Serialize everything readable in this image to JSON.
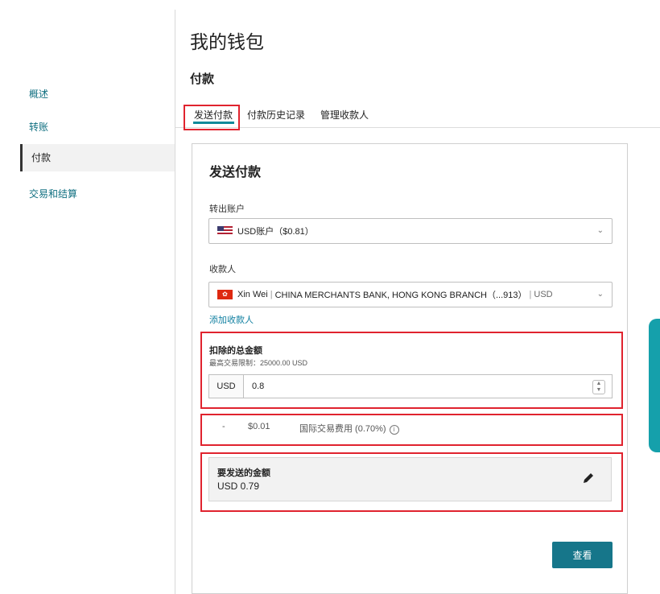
{
  "sidebar": {
    "items": [
      {
        "label": "概述"
      },
      {
        "label": "转账"
      },
      {
        "label": "付款"
      },
      {
        "label": "交易和结算"
      }
    ]
  },
  "header": {
    "title": "我的钱包",
    "section": "付款"
  },
  "tabs": [
    {
      "label": "发送付款"
    },
    {
      "label": "付款历史记录"
    },
    {
      "label": "管理收款人"
    }
  ],
  "form": {
    "title": "发送付款",
    "from_account": {
      "label": "转出账户",
      "value": "USD账户（$0.81）",
      "flag_icon": "us-flag-icon"
    },
    "payee": {
      "label": "收款人",
      "name": "Xin Wei",
      "bank": "CHINA MERCHANTS BANK, HONG KONG BRANCH（...913）",
      "currency": "USD",
      "flag_icon": "hk-flag-icon"
    },
    "add_payee_link": "添加收款人",
    "total": {
      "label": "扣除的总金额",
      "limit_note": "最高交易限制：25000.00 USD",
      "currency": "USD",
      "value": "0.8"
    },
    "fee": {
      "dash": "-",
      "amount": "$0.01",
      "label": "国际交易费用 (0.70%)"
    },
    "send_amount": {
      "label": "要发送的金额",
      "value": "USD 0.79"
    },
    "view_button": "查看"
  },
  "colors": {
    "accent": "#16768a",
    "link": "#0f7fa0",
    "highlight": "#e0232e",
    "side_tab": "#15a0ab"
  }
}
